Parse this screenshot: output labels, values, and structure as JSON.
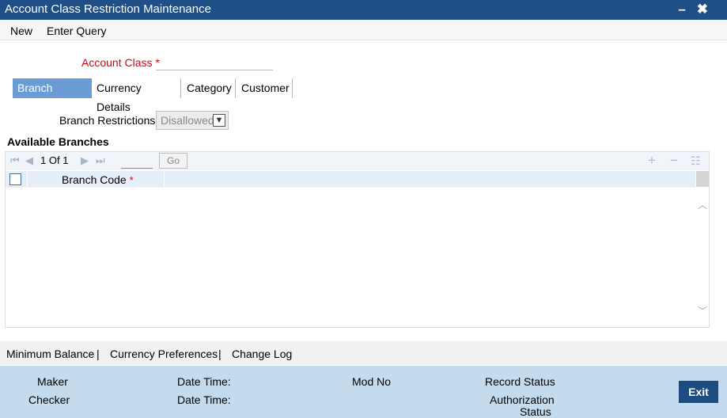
{
  "window": {
    "title": "Account Class Restriction Maintenance",
    "controls": "✖"
  },
  "menu": {
    "new": "New",
    "enter_query": "Enter Query"
  },
  "form": {
    "account_class_label": "Account Class",
    "required_mark": "*",
    "account_class_value": ""
  },
  "tabs": [
    {
      "label": "Branch Details",
      "active": true
    },
    {
      "label": "Currency Details",
      "active": false
    },
    {
      "label": "Category",
      "active": false
    },
    {
      "label": "Customer",
      "active": false
    }
  ],
  "branch": {
    "restrictions_label": "Branch Restrictions",
    "restrictions_value": "Disallowed"
  },
  "available": {
    "title": "Available Branches"
  },
  "pager": {
    "current": "1",
    "of_label": "Of",
    "total": "1",
    "go_label": "Go"
  },
  "grid": {
    "column_header": "Branch Code",
    "required_mark": "*"
  },
  "links": {
    "min_balance": "Minimum Balance",
    "sep": "|",
    "currency_prefs": "Currency Preferences",
    "change_log": "Change Log"
  },
  "footer": {
    "maker": "Maker",
    "checker": "Checker",
    "date_time_1": "Date Time:",
    "date_time_2": "Date Time:",
    "mod_no": "Mod No",
    "record_status": "Record Status",
    "auth_status_line1": "Authorization",
    "auth_status_line2": "Status",
    "exit": "Exit"
  },
  "icons": {
    "first": "first-page-icon",
    "prev": "prev-page-icon",
    "next": "next-page-icon",
    "last": "last-page-icon",
    "add": "add-row-icon",
    "delete": "delete-row-icon",
    "view": "single-view-icon"
  },
  "colors": {
    "title_bar": "#1f4f87",
    "active_tab": "#6b9cd6",
    "footer": "#c4daed",
    "exit_button": "#1d4c81",
    "required": "#d0021b"
  }
}
